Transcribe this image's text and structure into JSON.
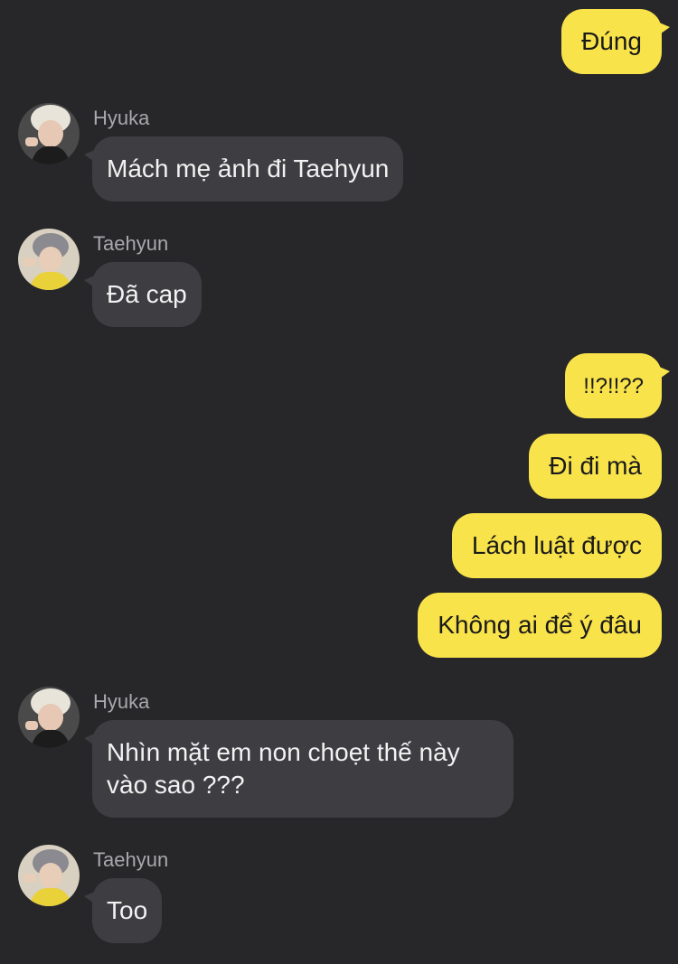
{
  "messages": {
    "m1": {
      "text": "Đúng"
    },
    "m2": {
      "sender": "Hyuka",
      "text": "Mách mẹ ảnh đi Taehyun"
    },
    "m3": {
      "sender": "Taehyun",
      "text": "Đã cap"
    },
    "m4": {
      "text": "!!?!!??"
    },
    "m5": {
      "text": "Đi đi mà"
    },
    "m6": {
      "text": "Lách luật được"
    },
    "m7": {
      "text": "Không ai để ý đâu"
    },
    "m8": {
      "sender": "Hyuka",
      "line1": "Nhìn mặt em non choẹt thế này",
      "line2": "vào sao ???"
    },
    "m9": {
      "sender": "Taehyun",
      "text": "Too"
    }
  },
  "colors": {
    "background": "#272729",
    "outgoing_bubble": "#f9e34a",
    "incoming_bubble": "#3e3e42",
    "sender_name": "#a9a9ad"
  }
}
